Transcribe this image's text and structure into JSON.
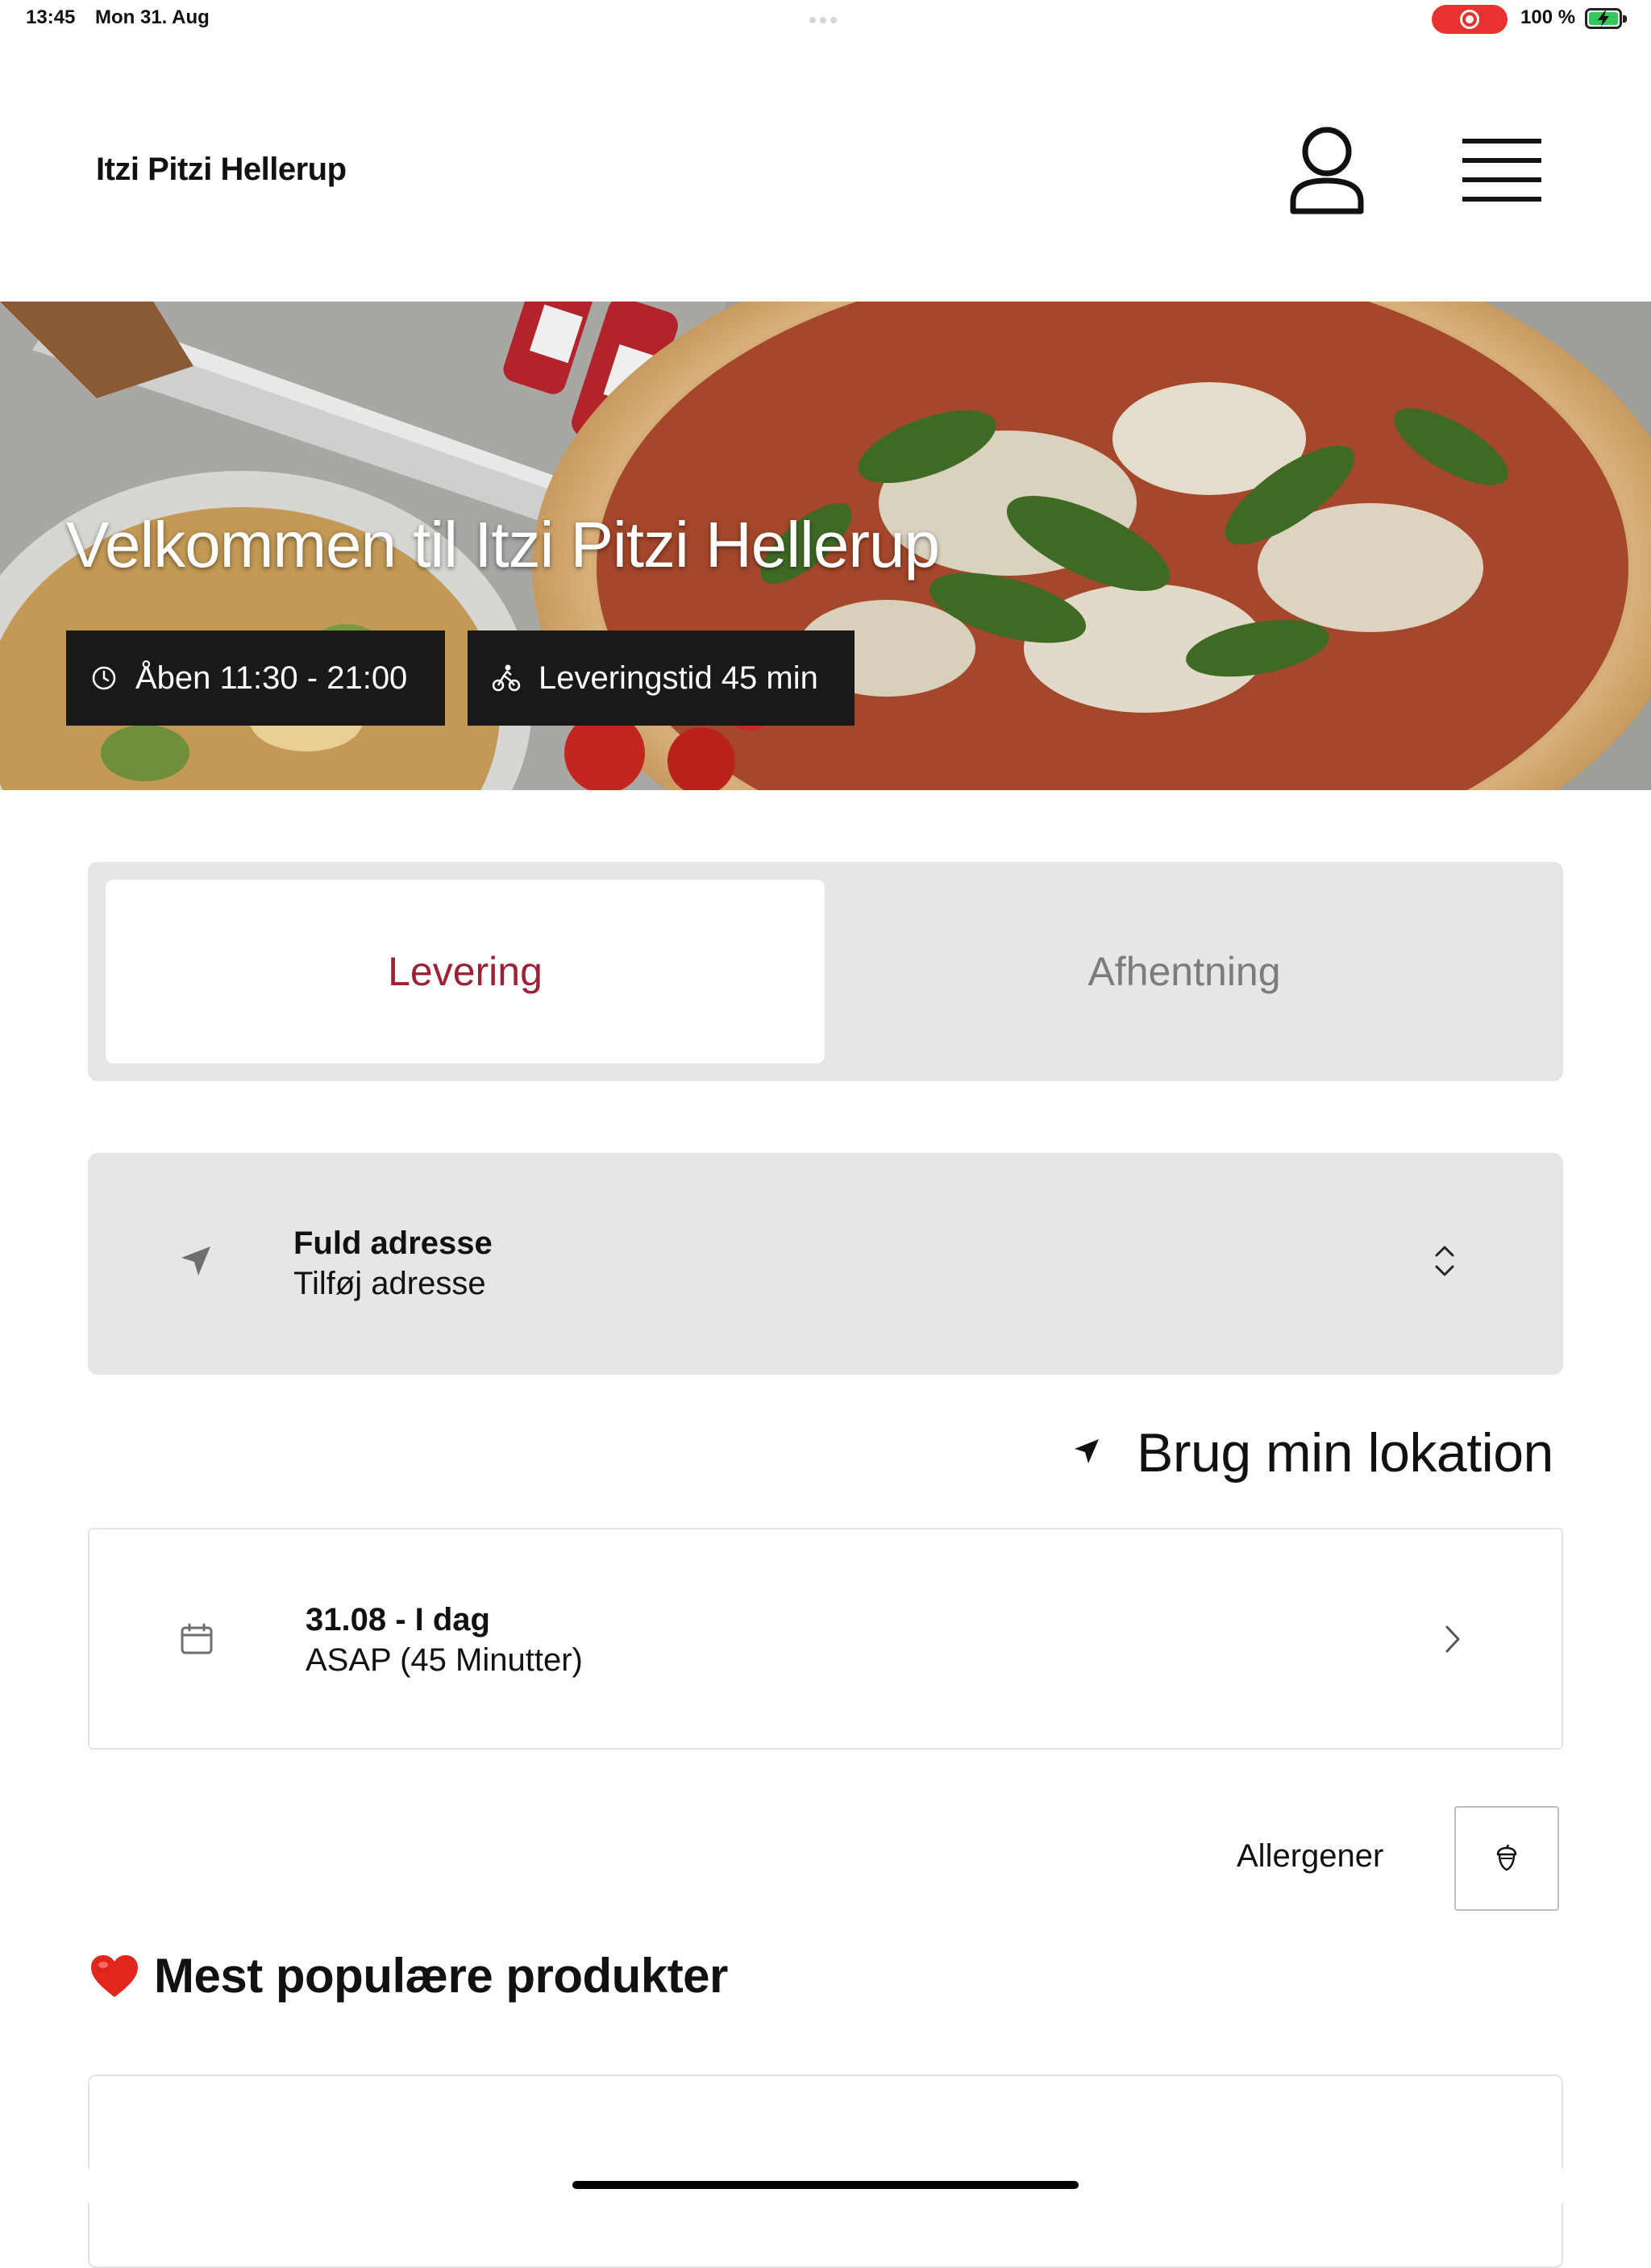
{
  "status_bar": {
    "time": "13:45",
    "date": "Mon 31. Aug",
    "battery": "100 %",
    "battery_level": 1.0
  },
  "header": {
    "brand": "Itzi Pitzi Hellerup",
    "icons": [
      "user-icon",
      "hamburger-menu-icon"
    ]
  },
  "hero": {
    "title": "Velkommen til Itzi Pitzi Hellerup",
    "open_hours": "Åben 11:30 - 21:00",
    "delivery_time": "Leveringstid 45 min",
    "icons": [
      "clock-icon",
      "cyclist-icon"
    ]
  },
  "order_type": {
    "options": [
      "Levering",
      "Afhentning"
    ],
    "selected": "Levering",
    "accent_color": "#9b2335"
  },
  "address": {
    "title": "Fuld adresse",
    "subtitle": "Tilføj adresse",
    "icons": [
      "location-arrow-icon",
      "chevron-up-down-icon"
    ]
  },
  "use_location": {
    "label": "Brug min lokation"
  },
  "delivery_date": {
    "title": "31.08 - I dag",
    "subtitle": "ASAP (45 Minutter)",
    "icons": [
      "calendar-icon",
      "chevron-right-icon"
    ]
  },
  "allergens": {
    "label": "Allergener",
    "icon": "acorn-icon"
  },
  "popular": {
    "emoji": "❤️",
    "title": "Mest populære produkter"
  }
}
